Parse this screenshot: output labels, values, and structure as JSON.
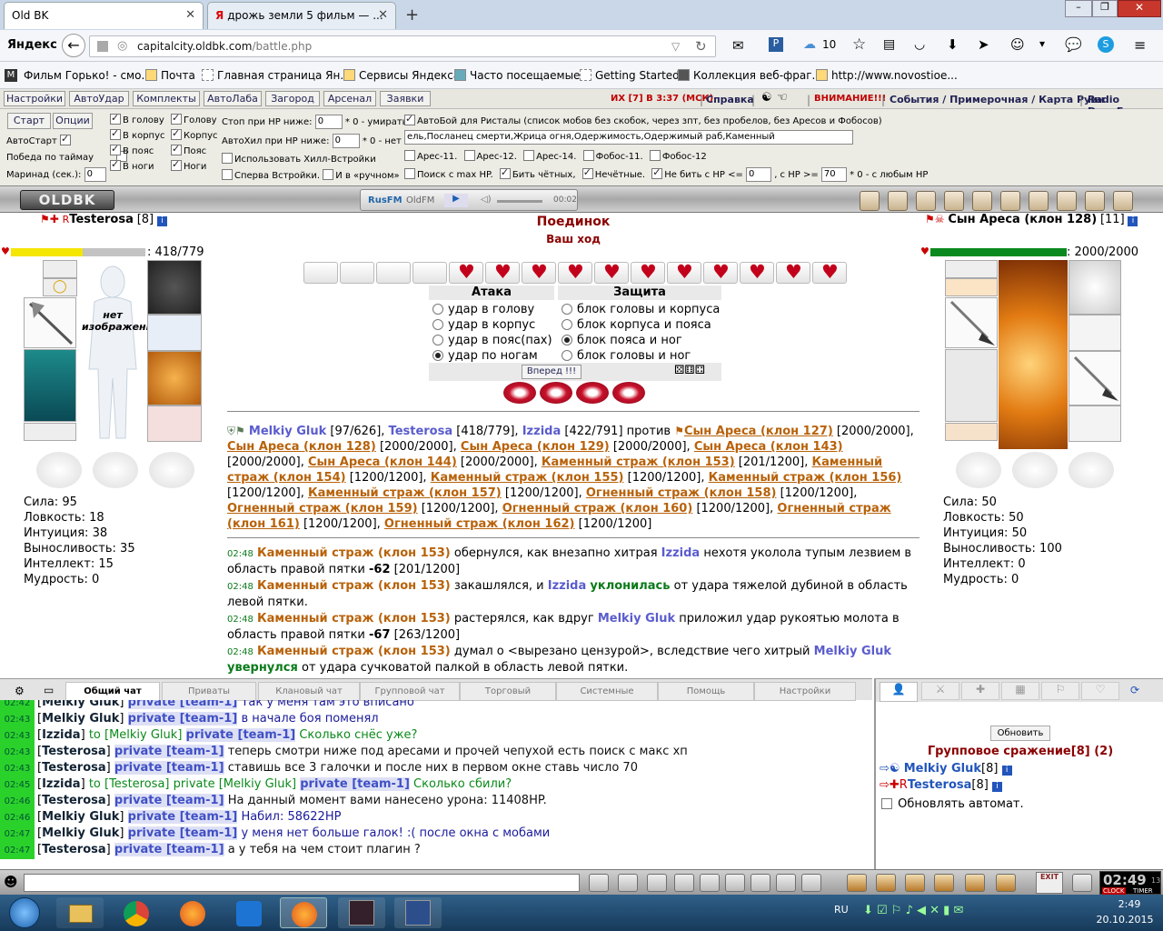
{
  "browser": {
    "tabs": [
      {
        "title": "Old BK",
        "active": true
      },
      {
        "title": "дрожь земли 5 фильм — ...",
        "active": false
      }
    ],
    "search_engine_label": "Яндекс",
    "url_domain": "capitalcity.oldbk.com",
    "url_path": "/battle.php",
    "weather_temp": "10",
    "bookmarks": [
      "Фильм Горько! - смо...",
      "Почта",
      "Главная страница Ян...",
      "Сервисы Яндекса",
      "Часто посещаемые",
      "Getting Started",
      "Коллекция веб-фраг...",
      "http://www.novostioe..."
    ]
  },
  "game_menu": {
    "buttons": [
      "Настройки",
      "АвтоУдар",
      "Комплекты",
      "АвтоЛаба",
      "Загород",
      "Арсенал",
      "Заявки"
    ],
    "info_red": "ИХ [7] В 3:37 (МСК)",
    "links": [
      "Справка",
      "ВНИМАНИЕ!!!",
      "События / Примерочная / Карта Руин",
      "Radio DeepFm"
    ]
  },
  "options": {
    "start_btn": "Старт",
    "options_btn": "Опции",
    "autostart": "АвтоСтарт",
    "win_timeout": "Победа по таймау",
    "marinade": "Маринад (сек.):",
    "marinade_val": "0",
    "attack_zones": [
      "В голову",
      "В корпус",
      "В пояс",
      "В ноги"
    ],
    "block_zones": [
      "Голову",
      "Корпус",
      "Пояс",
      "Ноги"
    ],
    "stop_hp": "Стоп при НР ниже:",
    "stop_hp_val": "0",
    "stop_hp_note": "* 0 - умирать",
    "autoheal": "АвтоХил при НР ниже:",
    "autoheal_val": "0",
    "autoheal_note": "* 0 - нет",
    "use_heal": "Использовать Хилл-Встройки",
    "first_builtin": "Сперва Встройки.",
    "and_manual": "И в «ручном»",
    "autobattle_label": "АвтоБой для Ристалы (список мобов без скобок, через зпт, без пробелов, без Аресов и Фобосов)",
    "autobattle_list": "ель,Посланец смерти,Жрица огня,Одержимость,Одержимый раб,Каменный страх,Огненный страх",
    "ares": [
      "Арес-11.",
      "Арес-12.",
      "Арес-14.",
      "Фобос-11.",
      "Фобос-12"
    ],
    "search_max": "Поиск с max HP.",
    "beat_even": "Бить чётных,",
    "odd": "Нечётные.",
    "dont_beat": "Не бить с НР <=",
    "dont_beat_val": "0",
    "hp_ge": ", с НР >=",
    "hp_ge_val": "70",
    "hp_note": "* 0 - с любым НР"
  },
  "radio": {
    "brand1": "RusFM",
    "brand2": "OldFM",
    "time": "00:02",
    "logo": "OLDBK"
  },
  "player": {
    "name": "Testerosa",
    "level": "[8]",
    "hp": "418/779",
    "hp_fraction": 0.537,
    "no_image": "нет изображения",
    "stats": [
      "Сила: 95",
      "Ловкость: 18",
      "Интуиция: 38",
      "Выносливость: 35",
      "Интеллект: 15",
      "Мудрость: 0"
    ]
  },
  "enemy": {
    "name": "Сын Ареса (клон 128)",
    "level": "[11]",
    "hp": "2000/2000",
    "hp_fraction": 1.0,
    "stats": [
      "Сила: 50",
      "Ловкость: 50",
      "Интуиция: 50",
      "Выносливость: 100",
      "Интеллект: 0",
      "Мудрость: 0"
    ]
  },
  "battle": {
    "title": "Поединок",
    "subtitle": "Ваш ход",
    "hearts_filled": 11,
    "hearts_empty": 4,
    "attack_header": "Атака",
    "defense_header": "Защита",
    "attacks": [
      "удар в голову",
      "удар в корпус",
      "удар в пояс(пах)",
      "удар по ногам"
    ],
    "attack_selected": 3,
    "defenses": [
      "блок головы и корпуса",
      "блок корпуса и пояса",
      "блок пояса и ног",
      "блок головы и ног"
    ],
    "defense_selected": 2,
    "forward_btn": "Вперед !!!"
  },
  "teams": {
    "team1": [
      {
        "name": "Melkiy Gluk",
        "hp": "[97/626],"
      },
      {
        "name": "Testerosa",
        "hp": "[418/779],"
      },
      {
        "name": "Izzida",
        "hp": "[422/791]"
      }
    ],
    "versus": "против",
    "team2": [
      {
        "name": "Сын Ареса (клон 127)",
        "hp": "[2000/2000],"
      },
      {
        "name": "Сын Ареса (клон 128)",
        "hp": "[2000/2000],"
      },
      {
        "name": "Сын Ареса (клон 129)",
        "hp": "[2000/2000],"
      },
      {
        "name": "Сын Ареса (клон 143)",
        "hp": "[2000/2000],"
      },
      {
        "name": "Сын Ареса (клон 144)",
        "hp": "[2000/2000],"
      },
      {
        "name": "Каменный страж (клон 153)",
        "hp": "[201/1200],"
      },
      {
        "name": "Каменный страж (клон 154)",
        "hp": "[1200/1200],"
      },
      {
        "name": "Каменный страж (клон 155)",
        "hp": "[1200/1200],"
      },
      {
        "name": "Каменный страж (клон 156)",
        "hp": "[1200/1200],"
      },
      {
        "name": "Каменный страж (клон 157)",
        "hp": "[1200/1200],"
      },
      {
        "name": "Огненный страж (клон 158)",
        "hp": "[1200/1200],"
      },
      {
        "name": "Огненный страж (клон 159)",
        "hp": "[1200/1200],"
      },
      {
        "name": "Огненный страж (клон 160)",
        "hp": "[1200/1200],"
      },
      {
        "name": "Огненный страж (клон 161)",
        "hp": "[1200/1200],"
      },
      {
        "name": "Огненный страж (клон 162)",
        "hp": "[1200/1200]"
      }
    ]
  },
  "battle_log": [
    {
      "time": "02:48",
      "actor": "Каменный страж (клон 153)",
      "t1": "обернулся, как внезапно хитрая",
      "who": "Izzida",
      "t2": "нехотя уколола тупым лезвием в область правой пятки",
      "dmg": "-62",
      "tail": "[201/1200]"
    },
    {
      "time": "02:48",
      "actor": "Каменный страж (клон 153)",
      "t1": "закашлялся, и",
      "who": "Izzida",
      "green": "уклонилась",
      "t2": "от удара тяжелой дубиной в область левой пятки."
    },
    {
      "time": "02:48",
      "actor": "Каменный страж (клон 153)",
      "t1": "растерялся, как вдруг",
      "who": "Melkiy Gluk",
      "t2": "приложил удар рукоятью молота в область правой пятки",
      "dmg": "-67",
      "tail": "[263/1200]"
    },
    {
      "time": "02:48",
      "actor": "Каменный страж (клон 153)",
      "t1": "думал о <вырезано цензурой>, вследствие чего хитрый",
      "who": "Melkiy Gluk",
      "green": "увернулся",
      "t2": "от удара сучковатой палкой в область левой пятки."
    }
  ],
  "chat": {
    "tabs": [
      "Общий чат",
      "Приваты",
      "Клановый чат",
      "Групповой чат",
      "Торговый",
      "Системные",
      "Помощь",
      "Настройки"
    ],
    "active_tab": 0,
    "messages": [
      {
        "time": "02:42",
        "from": "Melkiy Gluk",
        "to": "",
        "priv": "private [team-1]",
        "text": "Так у меня там это вписано"
      },
      {
        "time": "02:43",
        "from": "Melkiy Gluk",
        "to": "",
        "priv": "private [team-1]",
        "text": "в начале боя поменял"
      },
      {
        "time": "02:43",
        "from": "Izzida",
        "to": "to [Melkiy Gluk]",
        "priv": "private [team-1]",
        "text": "Сколько снёс уже?"
      },
      {
        "time": "02:43",
        "from": "Testerosa",
        "to": "",
        "priv": "private [team-1]",
        "text": "теперь смотри ниже под аресами и прочей чепухой есть поиск с макс хп"
      },
      {
        "time": "02:43",
        "from": "Testerosa",
        "to": "",
        "priv": "private [team-1]",
        "text": "ставишь все 3 галочки и после них в первом окне ставь число 70"
      },
      {
        "time": "02:45",
        "from": "Izzida",
        "to": "to [Testerosa] private [Melkiy Gluk]",
        "priv": "private [team-1]",
        "text": "Сколько сбили?"
      },
      {
        "time": "02:46",
        "from": "Testerosa",
        "to": "",
        "priv": "private [team-1]",
        "text": "На данный момент вами нанесено урона: 11408HP."
      },
      {
        "time": "02:46",
        "from": "Melkiy Gluk",
        "to": "",
        "priv": "private [team-1]",
        "text": "Набил: 58622HP"
      },
      {
        "time": "02:47",
        "from": "Melkiy Gluk",
        "to": "",
        "priv": "private [team-1]",
        "text": "у меня нет больше галок! :( после окна с мобами"
      },
      {
        "time": "02:47",
        "from": "Testerosa",
        "to": "",
        "priv": "private [team-1]",
        "text": "а у тебя на чем стоит плагин ?"
      }
    ]
  },
  "right_panel": {
    "refresh_btn": "Обновить",
    "group_title": "Групповое сражение[8] (2)",
    "members": [
      {
        "name": "Melkiy Gluk",
        "level": "[8]"
      },
      {
        "name": "Testerosa",
        "level": "[8]"
      }
    ],
    "auto_refresh": "Обновлять автомат."
  },
  "clock": {
    "time": "02:49",
    "sec": "13",
    "label1": "CLOCK",
    "label2": "TIMER",
    "exit": "EXIT"
  },
  "taskbar": {
    "lang": "RU",
    "time": "2:49",
    "date": "20.10.2015"
  },
  "colors": {
    "hp_yellow": "#f5e600",
    "hp_green": "#0a8a1e",
    "accent_red": "#c00000",
    "player_blue": "#5a5ccd",
    "enemy_orange": "#b8620a"
  }
}
